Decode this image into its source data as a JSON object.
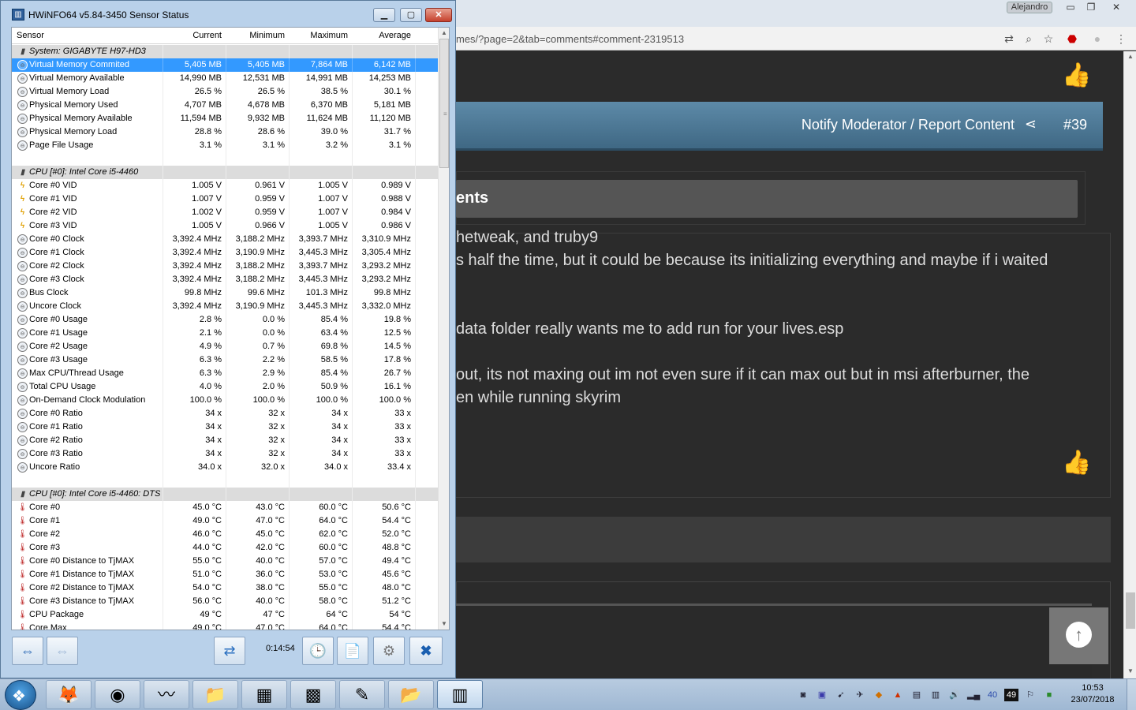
{
  "browser": {
    "user_badge": "Alejandro",
    "url": "mes/?page=2&tab=comments#comment-2319513",
    "post": {
      "report_label": "Notify Moderator / Report Content",
      "post_number": "#39",
      "section_title": "ents",
      "lines": [
        "hetweak, and truby9",
        "s half the time, but it could be because its initializing everything and maybe if i waited",
        "data folder really wants me to add run for your lives.esp",
        "out, its not maxing out im not even sure if it can max out but in msi afterburner, the",
        "en while running skyrim"
      ]
    }
  },
  "hwinfo": {
    "title": "HWiNFO64 v5.84-3450 Sensor Status",
    "columns": [
      "Sensor",
      "Current",
      "Minimum",
      "Maximum",
      "Average"
    ],
    "timer": "0:14:54",
    "rows": [
      {
        "type": "group",
        "name": "System: GIGABYTE H97-HD3"
      },
      {
        "type": "clock",
        "name": "Virtual Memory Commited",
        "v": [
          "5,405 MB",
          "5,405 MB",
          "7,864 MB",
          "6,142 MB"
        ],
        "selected": true
      },
      {
        "type": "clock",
        "name": "Virtual Memory Available",
        "v": [
          "14,990 MB",
          "12,531 MB",
          "14,991 MB",
          "14,253 MB"
        ]
      },
      {
        "type": "clock",
        "name": "Virtual Memory Load",
        "v": [
          "26.5 %",
          "26.5 %",
          "38.5 %",
          "30.1 %"
        ]
      },
      {
        "type": "clock",
        "name": "Physical Memory Used",
        "v": [
          "4,707 MB",
          "4,678 MB",
          "6,370 MB",
          "5,181 MB"
        ]
      },
      {
        "type": "clock",
        "name": "Physical Memory Available",
        "v": [
          "11,594 MB",
          "9,932 MB",
          "11,624 MB",
          "11,120 MB"
        ]
      },
      {
        "type": "clock",
        "name": "Physical Memory Load",
        "v": [
          "28.8 %",
          "28.6 %",
          "39.0 %",
          "31.7 %"
        ]
      },
      {
        "type": "clock",
        "name": "Page File Usage",
        "v": [
          "3.1 %",
          "3.1 %",
          "3.2 %",
          "3.1 %"
        ]
      },
      {
        "type": "blank"
      },
      {
        "type": "group",
        "name": "CPU [#0]: Intel Core i5-4460"
      },
      {
        "type": "volt",
        "name": "Core #0 VID",
        "v": [
          "1.005 V",
          "0.961 V",
          "1.005 V",
          "0.989 V"
        ]
      },
      {
        "type": "volt",
        "name": "Core #1 VID",
        "v": [
          "1.007 V",
          "0.959 V",
          "1.007 V",
          "0.988 V"
        ]
      },
      {
        "type": "volt",
        "name": "Core #2 VID",
        "v": [
          "1.002 V",
          "0.959 V",
          "1.007 V",
          "0.984 V"
        ]
      },
      {
        "type": "volt",
        "name": "Core #3 VID",
        "v": [
          "1.005 V",
          "0.966 V",
          "1.005 V",
          "0.986 V"
        ]
      },
      {
        "type": "clock",
        "name": "Core #0 Clock",
        "v": [
          "3,392.4 MHz",
          "3,188.2 MHz",
          "3,393.7 MHz",
          "3,310.9 MHz"
        ]
      },
      {
        "type": "clock",
        "name": "Core #1 Clock",
        "v": [
          "3,392.4 MHz",
          "3,190.9 MHz",
          "3,445.3 MHz",
          "3,305.4 MHz"
        ]
      },
      {
        "type": "clock",
        "name": "Core #2 Clock",
        "v": [
          "3,392.4 MHz",
          "3,188.2 MHz",
          "3,393.7 MHz",
          "3,293.2 MHz"
        ]
      },
      {
        "type": "clock",
        "name": "Core #3 Clock",
        "v": [
          "3,392.4 MHz",
          "3,188.2 MHz",
          "3,445.3 MHz",
          "3,293.2 MHz"
        ]
      },
      {
        "type": "clock",
        "name": "Bus Clock",
        "v": [
          "99.8 MHz",
          "99.6 MHz",
          "101.3 MHz",
          "99.8 MHz"
        ]
      },
      {
        "type": "clock",
        "name": "Uncore Clock",
        "v": [
          "3,392.4 MHz",
          "3,190.9 MHz",
          "3,445.3 MHz",
          "3,332.0 MHz"
        ]
      },
      {
        "type": "clock",
        "name": "Core #0 Usage",
        "v": [
          "2.8 %",
          "0.0 %",
          "85.4 %",
          "19.8 %"
        ]
      },
      {
        "type": "clock",
        "name": "Core #1 Usage",
        "v": [
          "2.1 %",
          "0.0 %",
          "63.4 %",
          "12.5 %"
        ]
      },
      {
        "type": "clock",
        "name": "Core #2 Usage",
        "v": [
          "4.9 %",
          "0.7 %",
          "69.8 %",
          "14.5 %"
        ]
      },
      {
        "type": "clock",
        "name": "Core #3 Usage",
        "v": [
          "6.3 %",
          "2.2 %",
          "58.5 %",
          "17.8 %"
        ]
      },
      {
        "type": "clock",
        "name": "Max CPU/Thread Usage",
        "v": [
          "6.3 %",
          "2.9 %",
          "85.4 %",
          "26.7 %"
        ]
      },
      {
        "type": "clock",
        "name": "Total CPU Usage",
        "v": [
          "4.0 %",
          "2.0 %",
          "50.9 %",
          "16.1 %"
        ]
      },
      {
        "type": "clock",
        "name": "On-Demand Clock Modulation",
        "v": [
          "100.0 %",
          "100.0 %",
          "100.0 %",
          "100.0 %"
        ]
      },
      {
        "type": "clock",
        "name": "Core #0 Ratio",
        "v": [
          "34 x",
          "32 x",
          "34 x",
          "33 x"
        ]
      },
      {
        "type": "clock",
        "name": "Core #1 Ratio",
        "v": [
          "34 x",
          "32 x",
          "34 x",
          "33 x"
        ]
      },
      {
        "type": "clock",
        "name": "Core #2 Ratio",
        "v": [
          "34 x",
          "32 x",
          "34 x",
          "33 x"
        ]
      },
      {
        "type": "clock",
        "name": "Core #3 Ratio",
        "v": [
          "34 x",
          "32 x",
          "34 x",
          "33 x"
        ]
      },
      {
        "type": "clock",
        "name": "Uncore Ratio",
        "v": [
          "34.0 x",
          "32.0 x",
          "34.0 x",
          "33.4 x"
        ]
      },
      {
        "type": "blank"
      },
      {
        "type": "group",
        "name": "CPU [#0]: Intel Core i5-4460: DTS"
      },
      {
        "type": "temp",
        "name": "Core #0",
        "v": [
          "45.0 °C",
          "43.0 °C",
          "60.0 °C",
          "50.6 °C"
        ]
      },
      {
        "type": "temp",
        "name": "Core #1",
        "v": [
          "49.0 °C",
          "47.0 °C",
          "64.0 °C",
          "54.4 °C"
        ]
      },
      {
        "type": "temp",
        "name": "Core #2",
        "v": [
          "46.0 °C",
          "45.0 °C",
          "62.0 °C",
          "52.0 °C"
        ]
      },
      {
        "type": "temp",
        "name": "Core #3",
        "v": [
          "44.0 °C",
          "42.0 °C",
          "60.0 °C",
          "48.8 °C"
        ]
      },
      {
        "type": "temp",
        "name": "Core #0 Distance to TjMAX",
        "v": [
          "55.0 °C",
          "40.0 °C",
          "57.0 °C",
          "49.4 °C"
        ]
      },
      {
        "type": "temp",
        "name": "Core #1 Distance to TjMAX",
        "v": [
          "51.0 °C",
          "36.0 °C",
          "53.0 °C",
          "45.6 °C"
        ]
      },
      {
        "type": "temp",
        "name": "Core #2 Distance to TjMAX",
        "v": [
          "54.0 °C",
          "38.0 °C",
          "55.0 °C",
          "48.0 °C"
        ]
      },
      {
        "type": "temp",
        "name": "Core #3 Distance to TjMAX",
        "v": [
          "56.0 °C",
          "40.0 °C",
          "58.0 °C",
          "51.2 °C"
        ]
      },
      {
        "type": "temp",
        "name": "CPU Package",
        "v": [
          "49 °C",
          "47 °C",
          "64 °C",
          "54 °C"
        ]
      },
      {
        "type": "temp",
        "name": "Core Max",
        "v": [
          "49.0 °C",
          "47.0 °C",
          "64.0 °C",
          "54.4 °C"
        ]
      }
    ]
  },
  "taskbar": {
    "apps": [
      {
        "name": "firefox",
        "icon": "🦊"
      },
      {
        "name": "chrome",
        "icon": "◉"
      },
      {
        "name": "monitor",
        "icon": "〰"
      },
      {
        "name": "explorer",
        "icon": "📁"
      },
      {
        "name": "minecraft",
        "icon": "▦"
      },
      {
        "name": "craft",
        "icon": "▩"
      },
      {
        "name": "notepad",
        "icon": "✎"
      },
      {
        "name": "explorer2",
        "icon": "📂"
      },
      {
        "name": "hwinfo",
        "icon": "▥"
      }
    ],
    "tray_badge": "49",
    "time": "10:53",
    "date": "23/07/2018"
  }
}
